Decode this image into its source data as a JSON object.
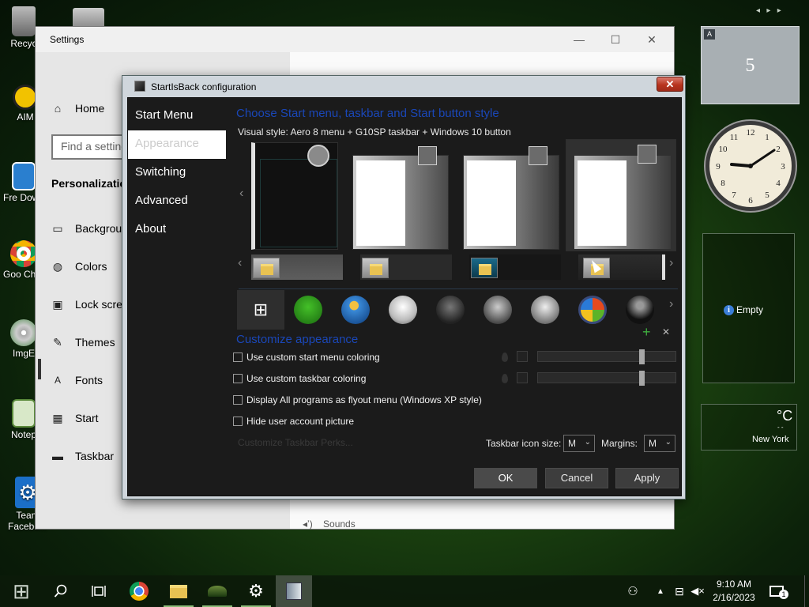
{
  "desktop": {
    "icons": [
      {
        "label": "Recyc"
      },
      {
        "label": "AIM"
      },
      {
        "label": "Fre Down"
      },
      {
        "label": "Goo Chro"
      },
      {
        "label": "ImgE"
      },
      {
        "label": "Notep"
      },
      {
        "label": "Team Facebo..."
      }
    ]
  },
  "gadgets": {
    "calendar": {
      "corner": "A",
      "day": "5",
      "nav_prev": "◂",
      "nav_play": "▸",
      "nav_next": "▸"
    },
    "slideshow": {
      "empty_label": "Empty"
    },
    "weather": {
      "unit": "°C",
      "dash": "- -",
      "city": "New York"
    }
  },
  "settings": {
    "title": "Settings",
    "minimize": "—",
    "maximize": "☐",
    "close": "✕",
    "home": "Home",
    "find_placeholder": "Find a setting",
    "section": "Personalization",
    "nav": [
      {
        "label": "Background"
      },
      {
        "label": "Colors"
      },
      {
        "label": "Lock screen"
      },
      {
        "label": "Themes"
      },
      {
        "label": "Fonts"
      },
      {
        "label": "Start"
      },
      {
        "label": "Taskbar"
      }
    ],
    "bottom_link": "Sounds"
  },
  "sib": {
    "title": "StartIsBack configuration",
    "close": "✕",
    "nav": [
      {
        "label": "Start Menu"
      },
      {
        "label": "Appearance"
      },
      {
        "label": "Switching"
      },
      {
        "label": "Advanced"
      },
      {
        "label": "About"
      }
    ],
    "heading_style": "Choose Start menu, taskbar and Start button style",
    "visual_style": "Visual style:  Aero 8 menu + G10SP taskbar + Windows 10 button",
    "heading_customize": "Customize appearance",
    "options": [
      {
        "label": "Use custom start menu coloring",
        "checked": false
      },
      {
        "label": "Use custom taskbar coloring",
        "checked": false
      },
      {
        "label": "Display All programs as flyout menu (Windows XP style)",
        "checked": false
      },
      {
        "label": "Hide user account picture",
        "checked": false
      }
    ],
    "perks_link": "Customize Taskbar Perks...",
    "icon_size_label": "Taskbar icon size:",
    "icon_size_value": "M",
    "margins_label": "Margins:",
    "margins_value": "M",
    "add_symbol": "+",
    "remove_symbol": "✕",
    "buttons": {
      "ok": "OK",
      "cancel": "Cancel",
      "apply": "Apply"
    },
    "colors": {
      "heading": "#1a47b8",
      "panel": "#1b1b1b"
    }
  },
  "taskbar": {
    "time": "9:10 AM",
    "date": "2/16/2023",
    "notification_count": "1",
    "icons": [
      "start-icon",
      "search-icon",
      "task-view-icon",
      "chrome-icon",
      "file-explorer-icon",
      "app-icon",
      "settings-icon",
      "startisback-icon"
    ]
  }
}
